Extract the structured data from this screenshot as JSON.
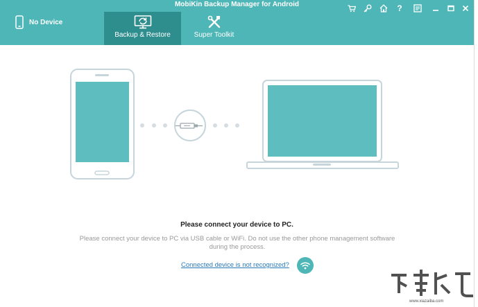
{
  "window": {
    "title": "MobiKin Backup Manager for Android"
  },
  "device": {
    "status": "No Device"
  },
  "tabs": [
    {
      "label": "Backup & Restore",
      "active": true
    },
    {
      "label": "Super Toolkit",
      "active": false
    }
  ],
  "window_controls": [
    "cart-icon",
    "key-icon",
    "home-icon",
    "help-icon",
    "feedback-icon",
    "minimize-icon",
    "maximize-icon",
    "close-icon"
  ],
  "main": {
    "prompt_title": "Please connect your device to PC.",
    "prompt_body": "Please connect your device to PC via USB cable or WiFi. Do not use the other phone management software during the process.",
    "help_link": "Connected device is not recognized?"
  },
  "watermark": {
    "url": "www.xiazaiba.com"
  },
  "colors": {
    "accent": "#4eb6b6",
    "accent_dark": "#2e8e8e",
    "link": "#2a7ab8"
  }
}
